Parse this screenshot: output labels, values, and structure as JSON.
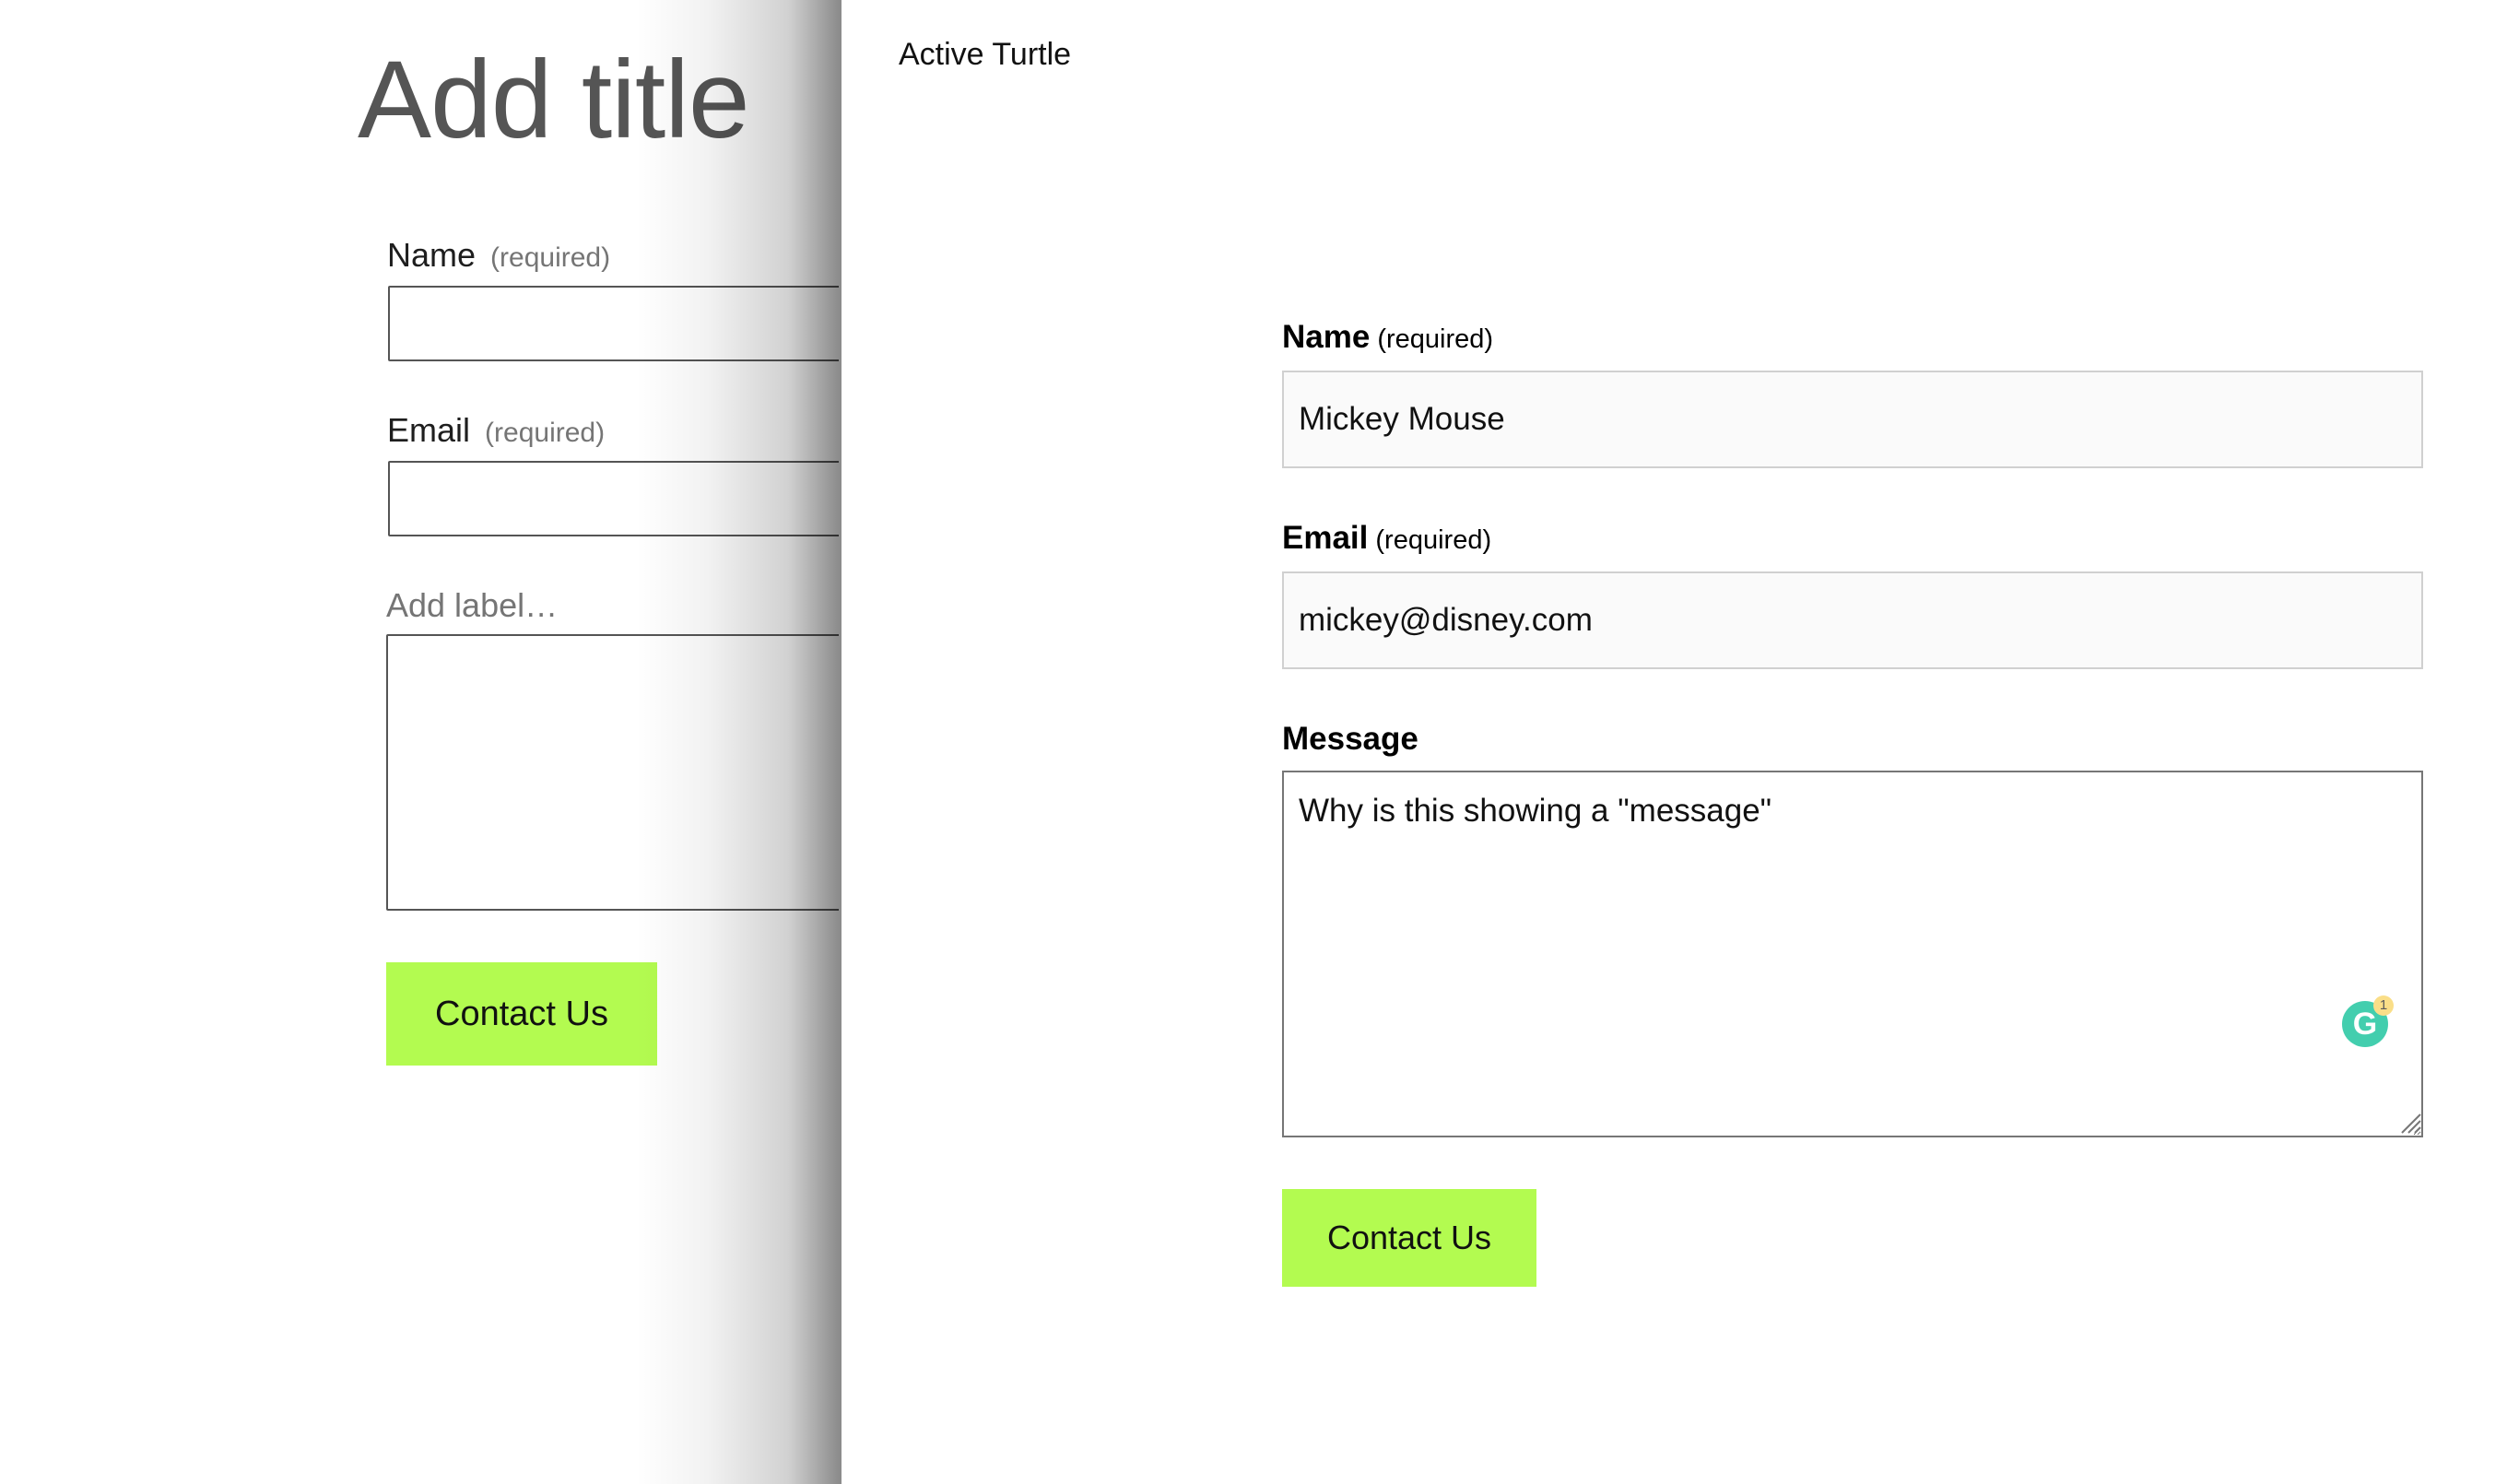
{
  "editor": {
    "title_placeholder": "Add title",
    "fields": [
      {
        "label": "Name",
        "required_text": "(required)"
      },
      {
        "label": "Email",
        "required_text": "(required)"
      }
    ],
    "textarea_label_placeholder": "Add label…",
    "submit_label": "Contact Us"
  },
  "preview": {
    "site_title": "Active Turtle",
    "name": {
      "label": "Name",
      "required_text": "(required)",
      "value": "Mickey Mouse"
    },
    "email": {
      "label": "Email",
      "required_text": "(required)",
      "value": "mickey@disney.com"
    },
    "message": {
      "label": "Message",
      "value": "Why is this showing a \"message\""
    },
    "submit_label": "Contact Us",
    "grammarly": {
      "letter": "G",
      "badge_count": "1"
    }
  },
  "colors": {
    "button_bg": "#b3fb50",
    "grammarly_green": "#15c39a"
  },
  "icons": {
    "grammarly": "grammarly-icon",
    "resize": "resize-handle-icon"
  }
}
